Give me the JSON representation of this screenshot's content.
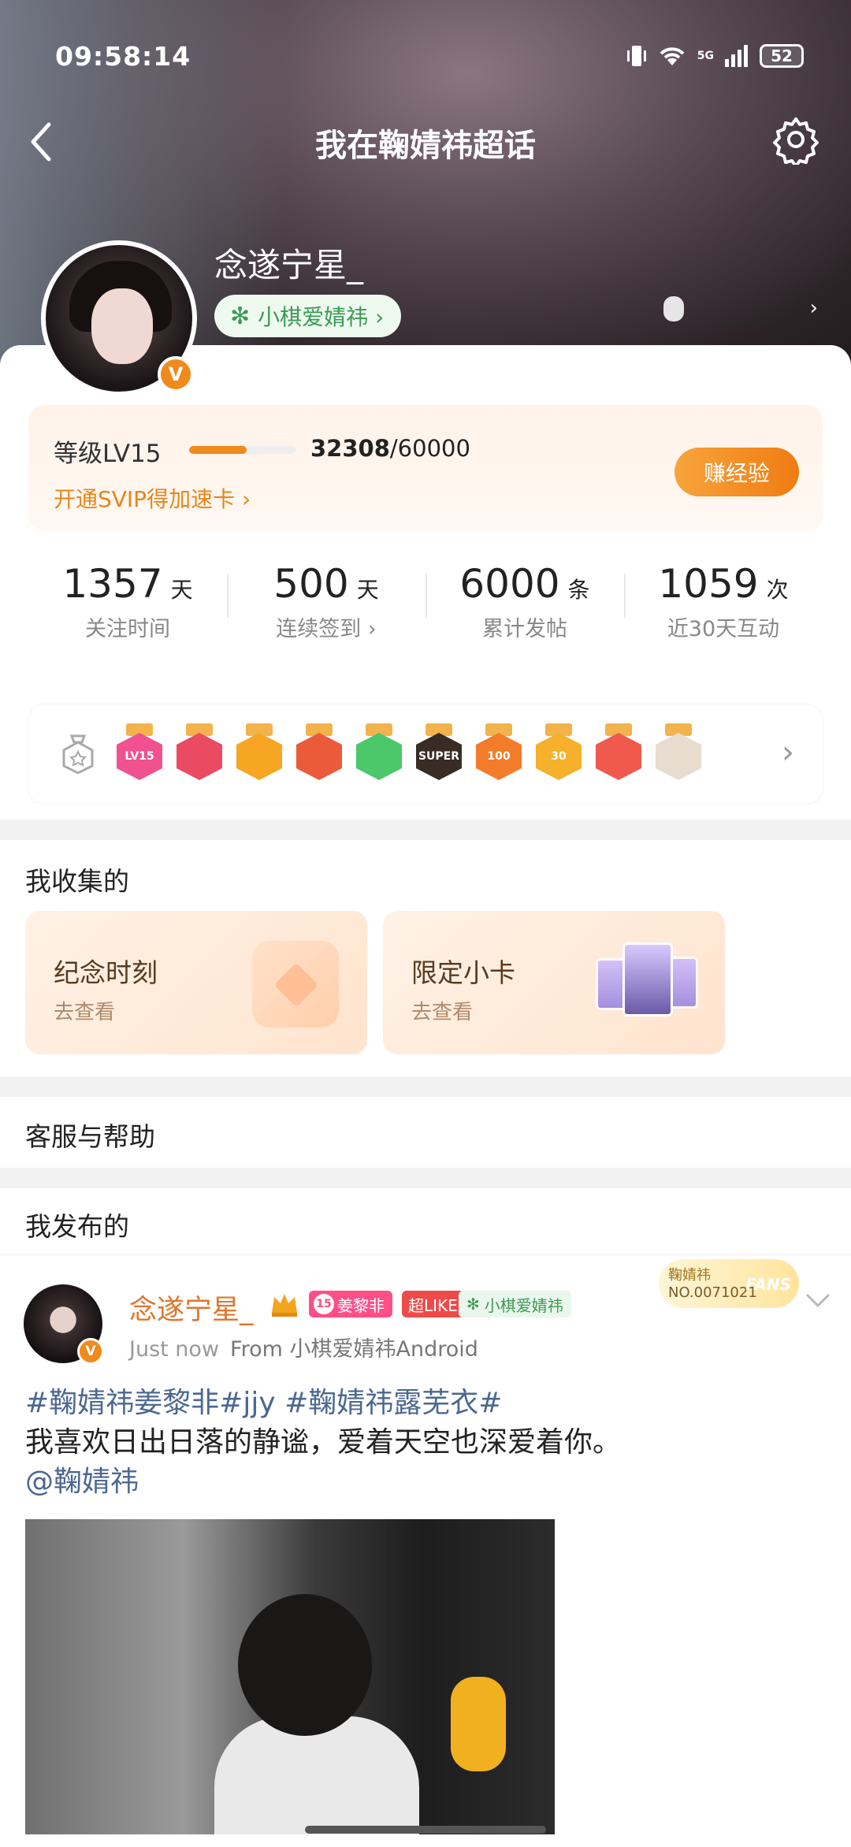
{
  "status_bar": {
    "time": "09:58:14",
    "signal_label": "5G",
    "battery": "52"
  },
  "nav": {
    "title": "我在鞠婧祎超话"
  },
  "profile": {
    "username": "念遂宁星_",
    "super_topic": "小棋爱婧祎 ›",
    "verified": "V"
  },
  "level": {
    "label": "等级LV15",
    "exp_current": "32308",
    "exp_total": "/60000",
    "progress": 0.54,
    "svip_text": "开通SVIP得加速卡 ›",
    "earn_button": "赚经验"
  },
  "stats": [
    {
      "value": "1357",
      "unit": "天",
      "label": "关注时间"
    },
    {
      "value": "500",
      "unit": "天",
      "label": "连续签到 ›"
    },
    {
      "value": "6000",
      "unit": "条",
      "label": "累计发帖"
    },
    {
      "value": "1059",
      "unit": "次",
      "label": "近30天互动"
    }
  ],
  "badges": [
    {
      "label": "LV15",
      "color": "#f0518f"
    },
    {
      "label": "",
      "color": "#ea4b62"
    },
    {
      "label": "",
      "color": "#f6a623"
    },
    {
      "label": "",
      "color": "#ec5a3c"
    },
    {
      "label": "",
      "color": "#4cc76a"
    },
    {
      "label": "SUPER",
      "color": "#3a2c24"
    },
    {
      "label": "100",
      "color": "#f37c2a"
    },
    {
      "label": "30",
      "color": "#f6b02b"
    },
    {
      "label": "",
      "color": "#f05a4c"
    },
    {
      "label": "",
      "color": "#e8dccf"
    }
  ],
  "collection": {
    "title": "我收集的",
    "cards": [
      {
        "title": "纪念时刻",
        "sub": "去查看"
      },
      {
        "title": "限定小卡",
        "sub": "去查看"
      }
    ]
  },
  "help": {
    "title": "客服与帮助"
  },
  "posts": {
    "title": "我发布的",
    "item": {
      "name": "念遂宁星_",
      "fans_level": "15",
      "fans_name": "姜黎非",
      "like_tag": "超LIKE",
      "super_tag": "小棋爱婧祎",
      "fans_card_name": "鞠婧祎",
      "fans_card_no": "NO.0071021",
      "fans_card_mark": "FANS",
      "time": "Just now",
      "source": "From 小棋爱婧祎Android",
      "topics": "#鞠婧祎姜黎非#jjy #鞠婧祎露芜衣#",
      "text": "我喜欢日出日落的静谧，爱着天空也深爱着你。",
      "mention": "@鞠婧祎"
    }
  }
}
